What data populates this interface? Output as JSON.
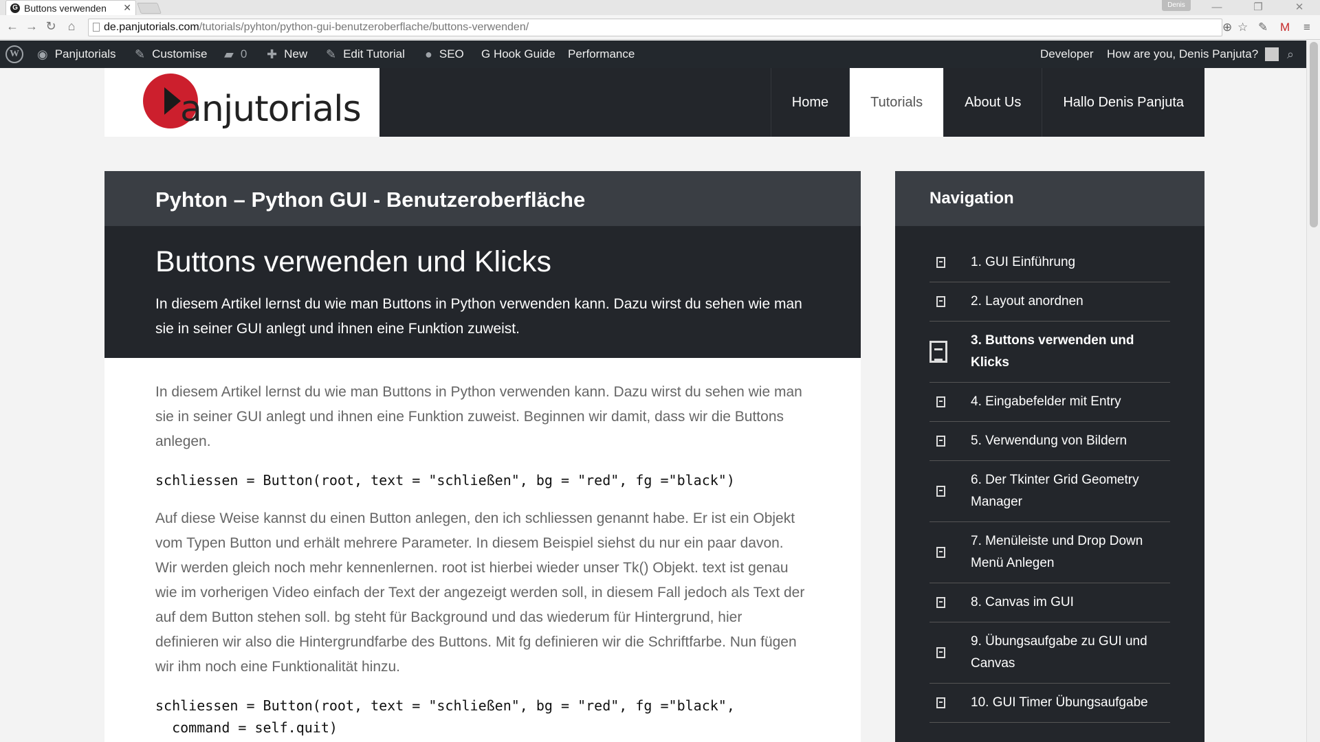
{
  "browser": {
    "tab_title": "Buttons verwenden",
    "tab_favicon": "G",
    "user_chip": "Denis",
    "url_domain": "de.panjutorials.com",
    "url_path": "/tutorials/pyhton/python-gui-benutzeroberflache/buttons-verwenden/"
  },
  "adminbar": {
    "site": "Panjutorials",
    "customise": "Customise",
    "comments_count": "0",
    "new": "New",
    "edit": "Edit Tutorial",
    "seo": "SEO",
    "hook_guide": "G Hook Guide",
    "performance": "Performance",
    "developer": "Developer",
    "greeting": "How are you, Denis Panjuta?"
  },
  "header": {
    "logo_text": "anjutorials",
    "nav": [
      "Home",
      "Tutorials",
      "About Us",
      "Hallo Denis Panjuta"
    ],
    "active_nav": "Tutorials"
  },
  "article": {
    "course_title": "Pyhton – Python GUI - Benutzeroberfläche",
    "title": "Buttons verwenden und Klicks",
    "lead": "In diesem Artikel lernst du wie man Buttons in Python verwenden kann. Dazu wirst du sehen wie man sie in seiner GUI anlegt und ihnen eine Funktion zuweist.",
    "p1": "In diesem Artikel lernst du wie man Buttons in Python verwenden kann. Dazu wirst du sehen wie man sie in seiner GUI anlegt und ihnen eine Funktion zuweist. Beginnen wir damit, dass wir die Buttons anlegen.",
    "code1": "schliessen = Button(root, text = \"schließen\", bg = \"red\", fg =\"black\")",
    "p2": "Auf diese Weise kannst du einen Button anlegen, den ich schliessen genannt habe. Er ist ein Objekt vom Typen Button und erhält mehrere Parameter. In diesem Beispiel siehst du nur ein paar davon. Wir werden gleich noch mehr kennenlernen. root ist hierbei wieder unser Tk() Objekt. text ist genau wie im vorherigen Video einfach der Text der angezeigt werden soll, in diesem Fall jedoch als Text der auf dem Button stehen soll. bg steht für Background und das wiederum für Hintergrund, hier definieren wir also die Hintergrundfarbe des Buttons. Mit fg definieren wir die Schriftfarbe. Nun fügen wir ihm noch eine Funktionalität hinzu.",
    "code2": "schliessen = Button(root, text = \"schließen\", bg = \"red\", fg =\"black\",\n  command = self.quit)"
  },
  "sidebar": {
    "title": "Navigation",
    "items": [
      "1. GUI Einführung",
      "2. Layout anordnen",
      "3. Buttons verwenden und Klicks",
      "4. Eingabefelder mit Entry",
      "5. Verwendung von Bildern",
      "6. Der Tkinter Grid Geometry Manager",
      "7. Menüleiste und Drop Down Menü Anlegen",
      "8. Canvas im GUI",
      "9. Übungsaufgabe zu GUI und Canvas",
      "10. GUI Timer Übungsaufgabe"
    ],
    "active_index": 2
  },
  "colors": {
    "dark": "#23262b",
    "dark_header": "#3a3e44",
    "logo_red": "#cc1f2d",
    "adminbar": "#23282d"
  }
}
